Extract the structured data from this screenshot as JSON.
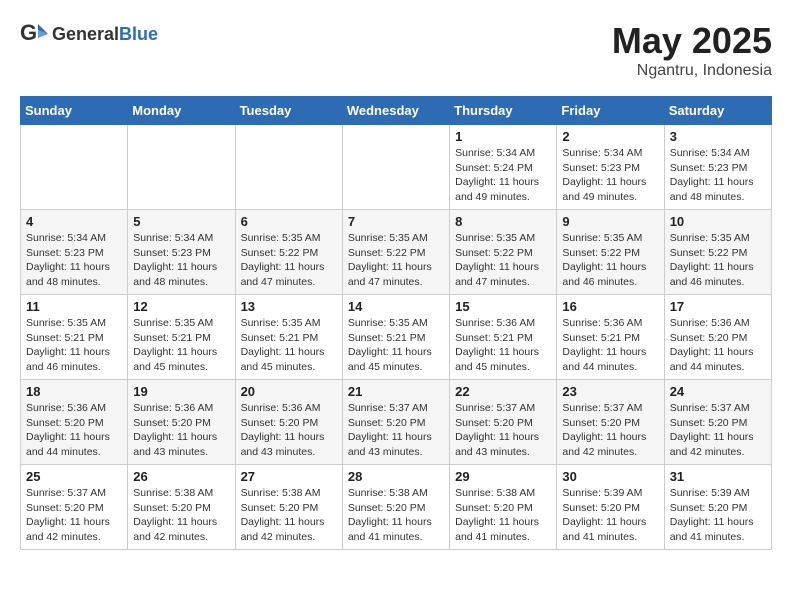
{
  "header": {
    "logo_general": "General",
    "logo_blue": "Blue",
    "month": "May 2025",
    "location": "Ngantru, Indonesia"
  },
  "days_of_week": [
    "Sunday",
    "Monday",
    "Tuesday",
    "Wednesday",
    "Thursday",
    "Friday",
    "Saturday"
  ],
  "weeks": [
    [
      {
        "day": "",
        "info": ""
      },
      {
        "day": "",
        "info": ""
      },
      {
        "day": "",
        "info": ""
      },
      {
        "day": "",
        "info": ""
      },
      {
        "day": "1",
        "info": "Sunrise: 5:34 AM\nSunset: 5:24 PM\nDaylight: 11 hours\nand 49 minutes."
      },
      {
        "day": "2",
        "info": "Sunrise: 5:34 AM\nSunset: 5:23 PM\nDaylight: 11 hours\nand 49 minutes."
      },
      {
        "day": "3",
        "info": "Sunrise: 5:34 AM\nSunset: 5:23 PM\nDaylight: 11 hours\nand 48 minutes."
      }
    ],
    [
      {
        "day": "4",
        "info": "Sunrise: 5:34 AM\nSunset: 5:23 PM\nDaylight: 11 hours\nand 48 minutes."
      },
      {
        "day": "5",
        "info": "Sunrise: 5:34 AM\nSunset: 5:23 PM\nDaylight: 11 hours\nand 48 minutes."
      },
      {
        "day": "6",
        "info": "Sunrise: 5:35 AM\nSunset: 5:22 PM\nDaylight: 11 hours\nand 47 minutes."
      },
      {
        "day": "7",
        "info": "Sunrise: 5:35 AM\nSunset: 5:22 PM\nDaylight: 11 hours\nand 47 minutes."
      },
      {
        "day": "8",
        "info": "Sunrise: 5:35 AM\nSunset: 5:22 PM\nDaylight: 11 hours\nand 47 minutes."
      },
      {
        "day": "9",
        "info": "Sunrise: 5:35 AM\nSunset: 5:22 PM\nDaylight: 11 hours\nand 46 minutes."
      },
      {
        "day": "10",
        "info": "Sunrise: 5:35 AM\nSunset: 5:22 PM\nDaylight: 11 hours\nand 46 minutes."
      }
    ],
    [
      {
        "day": "11",
        "info": "Sunrise: 5:35 AM\nSunset: 5:21 PM\nDaylight: 11 hours\nand 46 minutes."
      },
      {
        "day": "12",
        "info": "Sunrise: 5:35 AM\nSunset: 5:21 PM\nDaylight: 11 hours\nand 45 minutes."
      },
      {
        "day": "13",
        "info": "Sunrise: 5:35 AM\nSunset: 5:21 PM\nDaylight: 11 hours\nand 45 minutes."
      },
      {
        "day": "14",
        "info": "Sunrise: 5:35 AM\nSunset: 5:21 PM\nDaylight: 11 hours\nand 45 minutes."
      },
      {
        "day": "15",
        "info": "Sunrise: 5:36 AM\nSunset: 5:21 PM\nDaylight: 11 hours\nand 45 minutes."
      },
      {
        "day": "16",
        "info": "Sunrise: 5:36 AM\nSunset: 5:21 PM\nDaylight: 11 hours\nand 44 minutes."
      },
      {
        "day": "17",
        "info": "Sunrise: 5:36 AM\nSunset: 5:20 PM\nDaylight: 11 hours\nand 44 minutes."
      }
    ],
    [
      {
        "day": "18",
        "info": "Sunrise: 5:36 AM\nSunset: 5:20 PM\nDaylight: 11 hours\nand 44 minutes."
      },
      {
        "day": "19",
        "info": "Sunrise: 5:36 AM\nSunset: 5:20 PM\nDaylight: 11 hours\nand 43 minutes."
      },
      {
        "day": "20",
        "info": "Sunrise: 5:36 AM\nSunset: 5:20 PM\nDaylight: 11 hours\nand 43 minutes."
      },
      {
        "day": "21",
        "info": "Sunrise: 5:37 AM\nSunset: 5:20 PM\nDaylight: 11 hours\nand 43 minutes."
      },
      {
        "day": "22",
        "info": "Sunrise: 5:37 AM\nSunset: 5:20 PM\nDaylight: 11 hours\nand 43 minutes."
      },
      {
        "day": "23",
        "info": "Sunrise: 5:37 AM\nSunset: 5:20 PM\nDaylight: 11 hours\nand 42 minutes."
      },
      {
        "day": "24",
        "info": "Sunrise: 5:37 AM\nSunset: 5:20 PM\nDaylight: 11 hours\nand 42 minutes."
      }
    ],
    [
      {
        "day": "25",
        "info": "Sunrise: 5:37 AM\nSunset: 5:20 PM\nDaylight: 11 hours\nand 42 minutes."
      },
      {
        "day": "26",
        "info": "Sunrise: 5:38 AM\nSunset: 5:20 PM\nDaylight: 11 hours\nand 42 minutes."
      },
      {
        "day": "27",
        "info": "Sunrise: 5:38 AM\nSunset: 5:20 PM\nDaylight: 11 hours\nand 42 minutes."
      },
      {
        "day": "28",
        "info": "Sunrise: 5:38 AM\nSunset: 5:20 PM\nDaylight: 11 hours\nand 41 minutes."
      },
      {
        "day": "29",
        "info": "Sunrise: 5:38 AM\nSunset: 5:20 PM\nDaylight: 11 hours\nand 41 minutes."
      },
      {
        "day": "30",
        "info": "Sunrise: 5:39 AM\nSunset: 5:20 PM\nDaylight: 11 hours\nand 41 minutes."
      },
      {
        "day": "31",
        "info": "Sunrise: 5:39 AM\nSunset: 5:20 PM\nDaylight: 11 hours\nand 41 minutes."
      }
    ]
  ]
}
